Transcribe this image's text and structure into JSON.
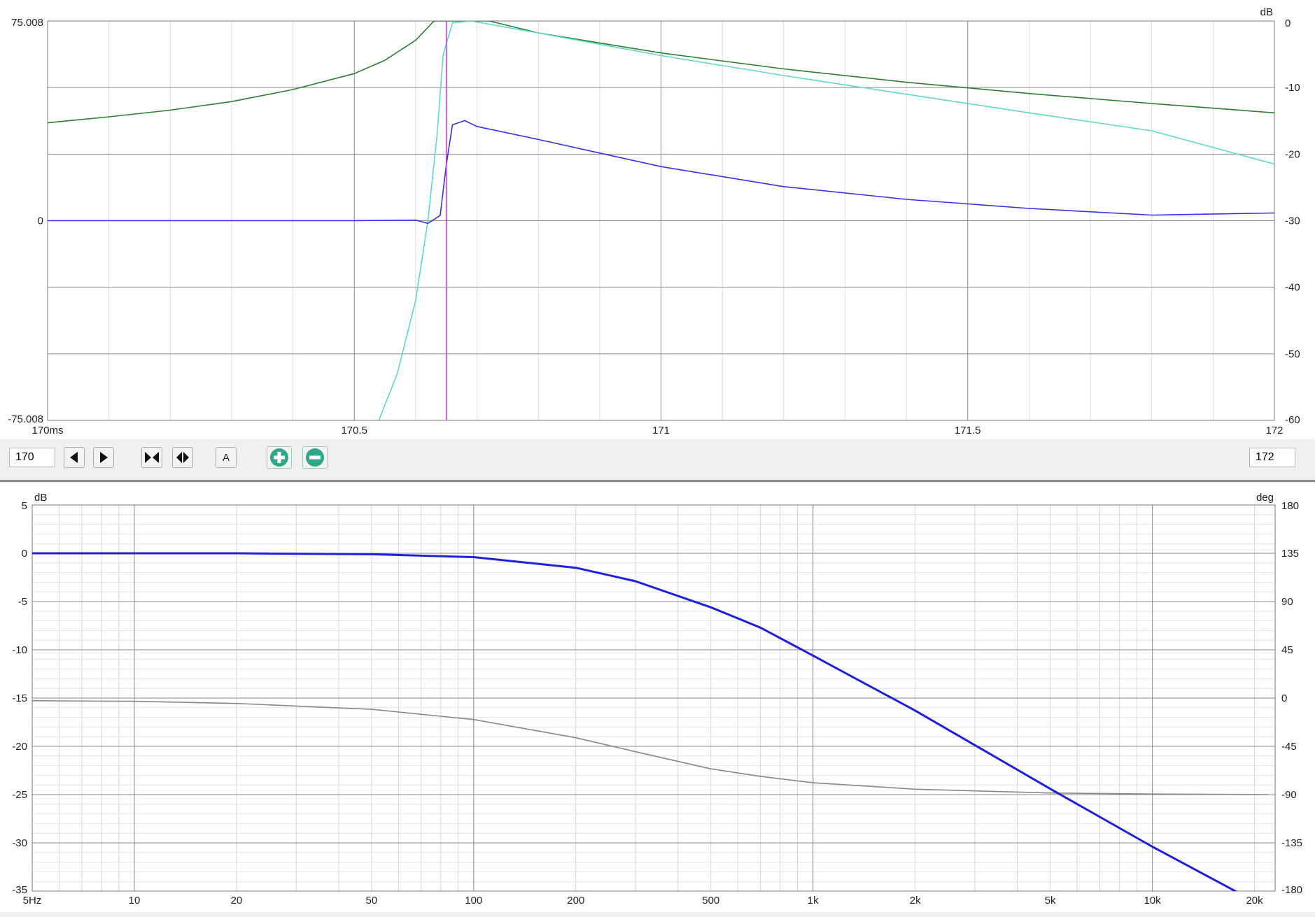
{
  "colors": {
    "green": "#2e7d32",
    "cyan": "#5fd8cc",
    "blue": "#3333ee",
    "magenta": "#ee22ee",
    "freq_magnitude": "#1f1fe0",
    "freq_phase": "#888888",
    "zoom_button": "#2fa88a"
  },
  "toolbar": {
    "start_value": "170",
    "end_value": "172",
    "buttons": [
      {
        "name": "step-left-button",
        "icon": "triangle-left-icon"
      },
      {
        "name": "step-right-button",
        "icon": "triangle-right-icon"
      },
      {
        "name": "fit-button",
        "icon": "bowtie-icon"
      },
      {
        "name": "expand-button",
        "icon": "diamond-split-icon"
      },
      {
        "name": "auto-button",
        "label": "A"
      },
      {
        "name": "zoom-in-button",
        "icon": "plus-circle-icon"
      },
      {
        "name": "zoom-out-button",
        "icon": "minus-circle-icon"
      }
    ]
  },
  "chart_data": [
    {
      "type": "line",
      "title": "",
      "x_tick_labels": [
        "170ms",
        "170.5",
        "171",
        "171.5",
        "172"
      ],
      "xlim": [
        170,
        172
      ],
      "left_axis": {
        "ylim": [
          -75.008,
          75.008
        ],
        "tick_labels": [
          "75.008",
          "0",
          "-75.008"
        ]
      },
      "right_axis": {
        "unit": "dB",
        "ylim": [
          -60,
          0
        ],
        "tick_labels": [
          "0",
          "-10",
          "-20",
          "-30",
          "-40",
          "-50",
          "-60"
        ]
      },
      "grid": true,
      "cursor_x": 170.65,
      "series": [
        {
          "axis": "right",
          "color": "green",
          "x": [
            170,
            170.1,
            170.2,
            170.3,
            170.4,
            170.5,
            170.55,
            170.6,
            170.63,
            170.72,
            170.8,
            170.9,
            171,
            171.2,
            171.4,
            171.6,
            171.8,
            172
          ],
          "y": [
            -15.3,
            -14.4,
            -13.4,
            -12.1,
            -10.3,
            -7.9,
            -5.9,
            -2.9,
            0,
            0,
            -1.8,
            -3.3,
            -4.8,
            -7.2,
            -9.2,
            -10.9,
            -12.4,
            -13.8
          ]
        },
        {
          "axis": "right",
          "color": "cyan",
          "x": [
            170.54,
            170.57,
            170.6,
            170.62,
            170.635,
            170.645,
            170.66,
            170.69,
            170.8,
            171,
            171.2,
            171.4,
            171.6,
            171.8,
            172
          ],
          "y": [
            -60,
            -53,
            -42,
            -30,
            -17,
            -5,
            -0.3,
            0,
            -1.8,
            -5.2,
            -8.2,
            -11,
            -13.8,
            -16.5,
            -21.5
          ]
        },
        {
          "axis": "left",
          "color": "blue",
          "x": [
            170,
            170.3,
            170.5,
            170.6,
            170.62,
            170.64,
            170.65,
            170.66,
            170.68,
            170.7,
            170.8,
            170.9,
            171,
            171.2,
            171.4,
            171.6,
            171.8,
            172
          ],
          "y": [
            0,
            0,
            0,
            0.2,
            -1,
            2,
            21,
            36,
            37.6,
            35.4,
            30.5,
            25.4,
            20.3,
            12.8,
            8,
            4.6,
            2.1,
            2.9
          ]
        }
      ]
    },
    {
      "type": "line",
      "title": "",
      "xscale": "log",
      "xlim": [
        5,
        23000
      ],
      "x_ticks": [
        5,
        10,
        20,
        50,
        100,
        200,
        500,
        1000,
        2000,
        5000,
        10000,
        20000
      ],
      "x_tick_labels": [
        "5Hz",
        "10",
        "20",
        "50",
        "100",
        "200",
        "500",
        "1k",
        "2k",
        "5k",
        "10k",
        "20k"
      ],
      "left_axis": {
        "unit": "dB",
        "ylim": [
          -35,
          5
        ],
        "tick_labels": [
          "5",
          "0",
          "-5",
          "-10",
          "-15",
          "-20",
          "-25",
          "-30",
          "-35"
        ]
      },
      "right_axis": {
        "unit": "deg",
        "ylim": [
          -180,
          180
        ],
        "tick_labels": [
          "180",
          "135",
          "90",
          "45",
          "0",
          "-45",
          "-90",
          "-135",
          "-180"
        ]
      },
      "grid": true,
      "series": [
        {
          "axis": "left",
          "color": "freq_magnitude",
          "x": [
            5,
            10,
            20,
            50,
            100,
            200,
            300,
            500,
            700,
            1000,
            2000,
            5000,
            10000,
            18000
          ],
          "y": [
            0,
            0,
            0,
            -0.1,
            -0.4,
            -1.5,
            -2.9,
            -5.6,
            -7.7,
            -10.6,
            -16.3,
            -24.4,
            -30.4,
            -35.2
          ]
        },
        {
          "axis": "right",
          "color": "freq_phase",
          "x": [
            5,
            10,
            20,
            50,
            100,
            200,
            300,
            500,
            700,
            1000,
            2000,
            5000,
            10000,
            22000
          ],
          "y": [
            -2.5,
            -3,
            -5,
            -10.5,
            -20,
            -37,
            -50,
            -66,
            -73,
            -79,
            -85,
            -88.5,
            -89.5,
            -90
          ]
        }
      ]
    }
  ]
}
